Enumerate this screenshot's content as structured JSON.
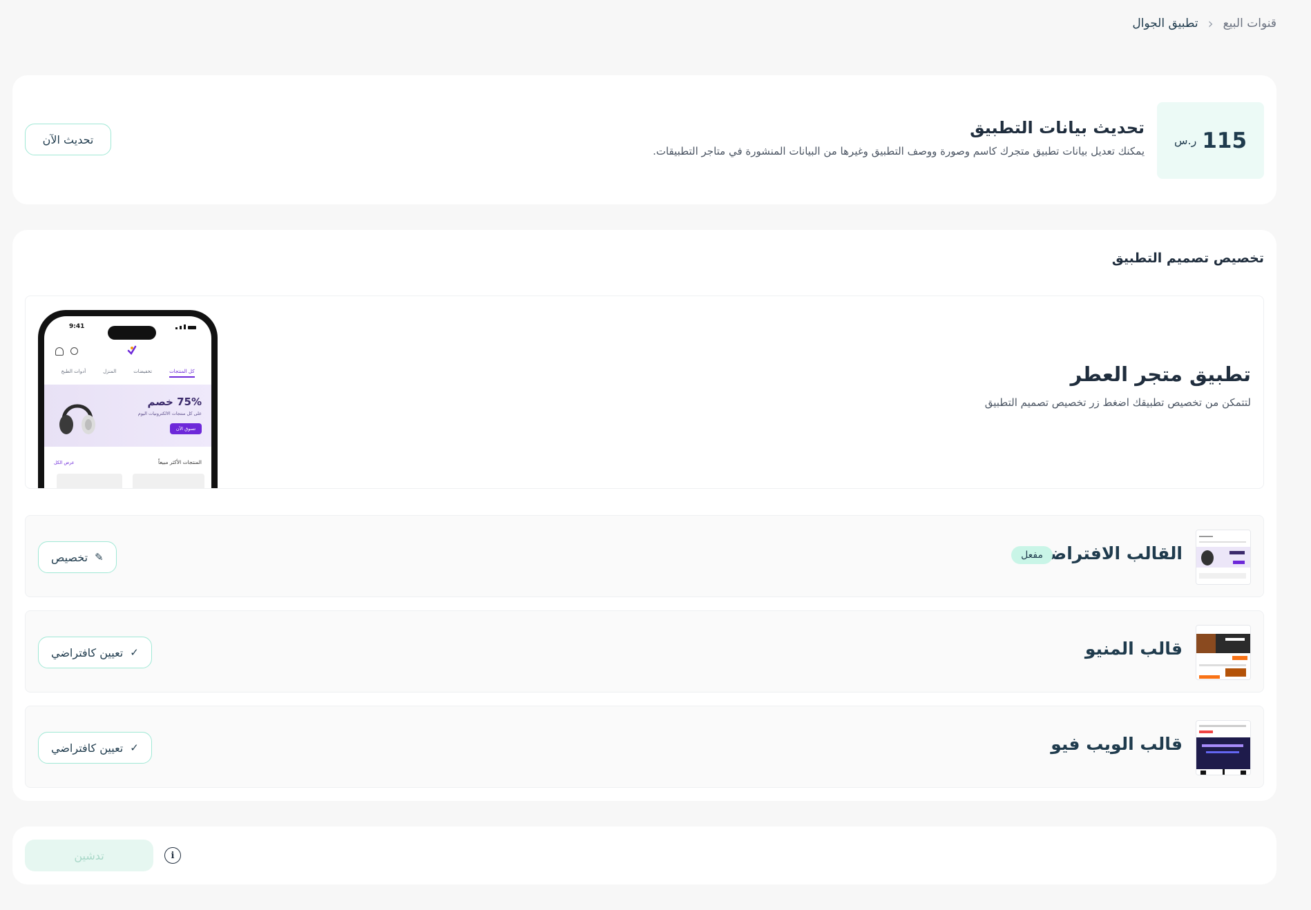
{
  "breadcrumb": {
    "items": [
      "قنوات البيع",
      "تطبيق الجوال"
    ],
    "separator": "‹"
  },
  "update_card": {
    "price_amount": "115",
    "price_currency": "ر.س",
    "title": "تحديث بيانات التطبيق",
    "description": "يمكنك تعديل بيانات تطبيق متجرك كاسم وصورة ووصف التطبيق وغيرها من البيانات المنشورة في متاجر التطبيقات.",
    "button_label": "تحديث الآن"
  },
  "design_card": {
    "heading": "تخصيص تصميم التطبيق",
    "store_title": "تطبيق متجر العطر",
    "store_description": "لتتمكن من تخصيص تطبيقك اضغط زر تخصيص تصميم التطبيق",
    "phone_preview": {
      "time": "9:41",
      "tabs": [
        "كل المنتجات",
        "تخفيضات",
        "المنزل",
        "أدوات الطبخ"
      ],
      "promo_title": "75% خصم",
      "promo_subtitle": "على كل منتجات الالكترونيات اليوم",
      "promo_button": "تسوق الآن",
      "best_sellers": "المنتجات الأكثر مبيعاً",
      "view_all": "عرض الكل"
    },
    "templates": [
      {
        "name": "القالب الافتراضي",
        "badge": "مفعل",
        "button_label": "تخصيص",
        "button_icon": "pencil-icon"
      },
      {
        "name": "قالب المنيو",
        "button_label": "تعيين كافتراضي",
        "button_icon": "check-icon"
      },
      {
        "name": "قالب الويب فيو",
        "button_label": "تعيين كافتراضي",
        "button_icon": "check-icon"
      }
    ]
  },
  "launch_card": {
    "button_label": "تدشين",
    "info_icon": "info-icon"
  },
  "colors": {
    "accent_border": "#9fe8d5",
    "badge_bg": "#c9f5e7",
    "price_bg": "#ecfaf6",
    "promo_purple": "#6d28d9"
  }
}
